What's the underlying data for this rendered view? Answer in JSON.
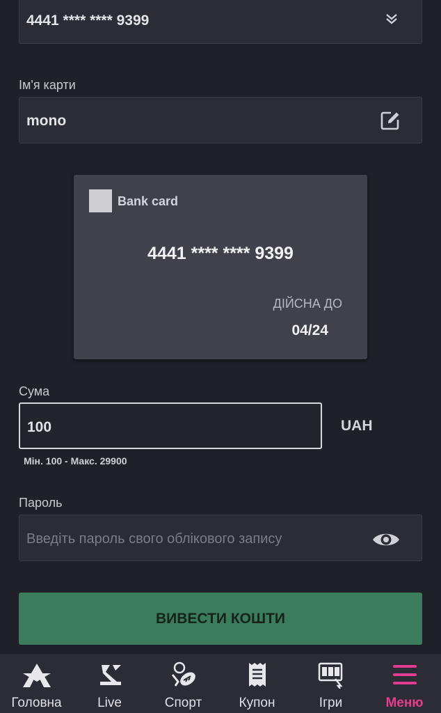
{
  "card_select": {
    "value": "4441 **** **** 9399",
    "icon": "chevron-double-down-icon"
  },
  "card_name": {
    "label": "Ім'я карти",
    "value": "mono",
    "icon": "edit-icon"
  },
  "bank_card": {
    "type": "Bank card",
    "number": "4441 **** **** 9399",
    "valid_label": "ДІЙСНА ДО",
    "valid_value": "04/24"
  },
  "amount": {
    "label": "Сума",
    "value": "100",
    "currency": "UAH",
    "limits": "Мін. 100 - Макс. 29900"
  },
  "password": {
    "label": "Пароль",
    "placeholder": "Введіть пароль свого облікового запису",
    "icon": "eye-icon"
  },
  "withdraw_button": "ВИВЕСТИ КОШТИ",
  "nav": {
    "items": [
      {
        "label": "Головна",
        "icon": "home-logo-icon"
      },
      {
        "label": "Live",
        "icon": "live-icon"
      },
      {
        "label": "Спорт",
        "icon": "sport-icon"
      },
      {
        "label": "Купон",
        "icon": "coupon-icon"
      },
      {
        "label": "Ігри",
        "icon": "slot-machine-icon"
      },
      {
        "label": "Меню",
        "icon": "menu-icon"
      }
    ],
    "active_color": "#e43d8e"
  },
  "colors": {
    "background": "#1f2028",
    "field": "#2b2c35",
    "card": "#40414b",
    "button": "#3a7c5c"
  }
}
